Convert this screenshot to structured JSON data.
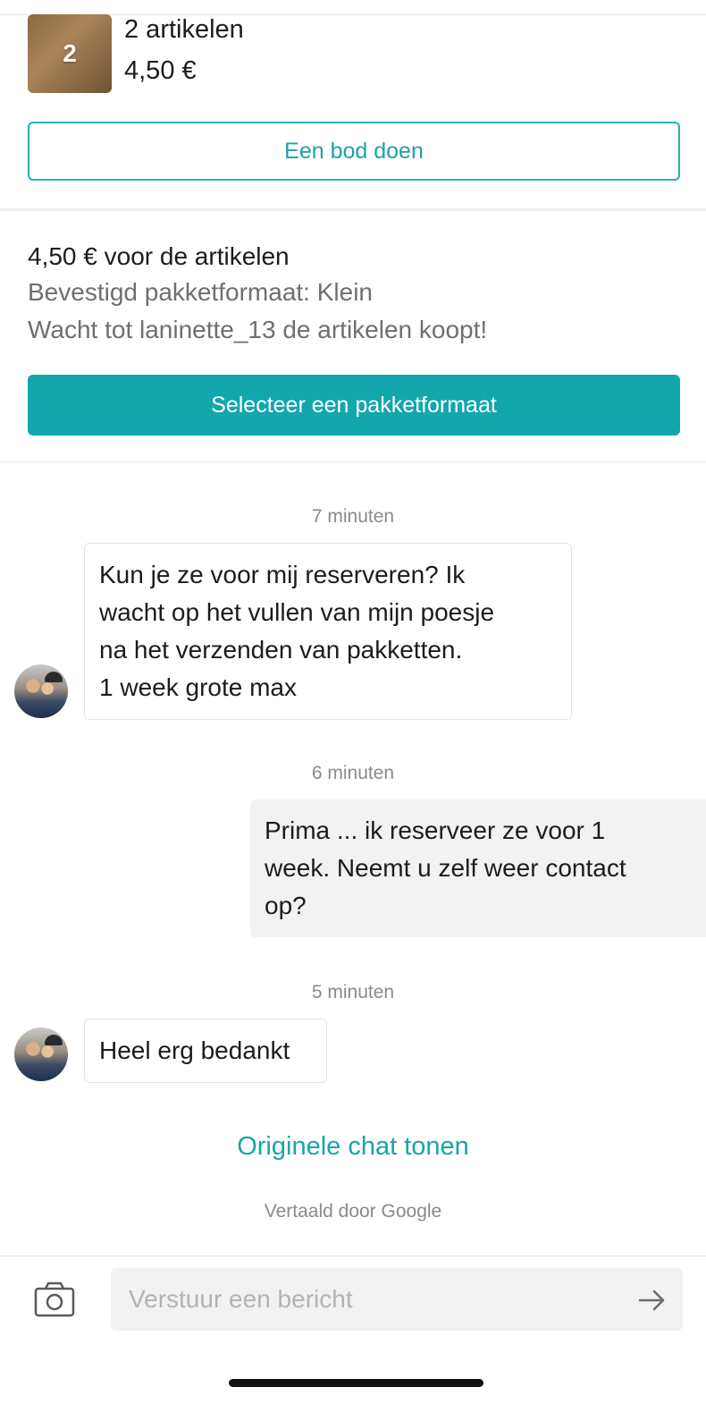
{
  "item": {
    "thumbnail_count": "2",
    "title": "2 artikelen",
    "price": "4,50 €"
  },
  "offer_button_label": "Een bod doen",
  "summary": {
    "total_line": "4,50 € voor de artikelen",
    "package_line": "Bevestigd pakketformaat: Klein",
    "wait_line": "Wacht tot laninette_13 de artikelen koopt!"
  },
  "package_button_label": "Selecteer een pakketformaat",
  "messages": [
    {
      "timestamp": "7 minuten",
      "direction": "incoming",
      "lines": [
        "Kun je ze voor mij reserveren? Ik",
        "wacht op het vullen van mijn poesje",
        "na het verzenden van pakketten.",
        "1 week grote max"
      ]
    },
    {
      "timestamp": "6 minuten",
      "direction": "outgoing",
      "lines": [
        "Prima ... ik reserveer ze voor 1",
        "week. Neemt u zelf weer contact",
        "op?"
      ]
    },
    {
      "timestamp": "5 minuten",
      "direction": "incoming",
      "lines": [
        "Heel erg bedankt"
      ]
    }
  ],
  "original_chat_link": "Originele chat tonen",
  "translated_note": "Vertaald door Google",
  "composer": {
    "placeholder": "Verstuur een bericht",
    "camera_icon": "camera-icon",
    "send_icon": "arrow-right-icon"
  },
  "colors": {
    "accent": "#13a7ad",
    "accent_text": "#1aa3a8",
    "outgoing_bubble": "#f2f2f2"
  }
}
